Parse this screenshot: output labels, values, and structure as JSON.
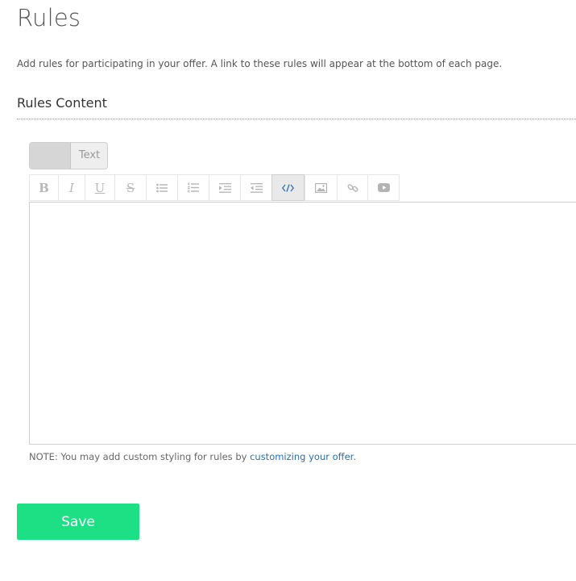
{
  "page": {
    "title": "Rules",
    "description": "Add rules for participating in your offer. A link to these rules will appear at the bottom of each page."
  },
  "section": {
    "title": "Rules Content"
  },
  "editor": {
    "mode_toggle_label": "Text",
    "toolbar": [
      {
        "name": "bold",
        "glyph": "B",
        "icon": "bold-icon"
      },
      {
        "name": "italic",
        "glyph": "I",
        "icon": "italic-icon"
      },
      {
        "name": "underline",
        "glyph": "U",
        "icon": "underline-icon"
      },
      {
        "name": "strikethrough",
        "glyph": "S",
        "icon": "strikethrough-icon"
      },
      {
        "name": "bulleted-list",
        "icon": "bulleted-list-icon"
      },
      {
        "name": "numbered-list",
        "icon": "numbered-list-icon"
      },
      {
        "name": "indent",
        "icon": "indent-icon"
      },
      {
        "name": "outdent",
        "icon": "outdent-icon"
      },
      {
        "name": "html-source",
        "icon": "code-icon",
        "active": true
      },
      {
        "name": "image",
        "icon": "image-icon"
      },
      {
        "name": "link",
        "icon": "link-icon"
      },
      {
        "name": "video",
        "icon": "video-icon"
      }
    ],
    "content": ""
  },
  "note": {
    "prefix": "NOTE: You may add custom styling for rules by ",
    "link_text": "customizing your offer",
    "suffix": "."
  },
  "actions": {
    "save_label": "Save"
  },
  "colors": {
    "save_button": "#1de085",
    "link": "#2a6fb0",
    "active_tool": "#2d6fb0"
  }
}
